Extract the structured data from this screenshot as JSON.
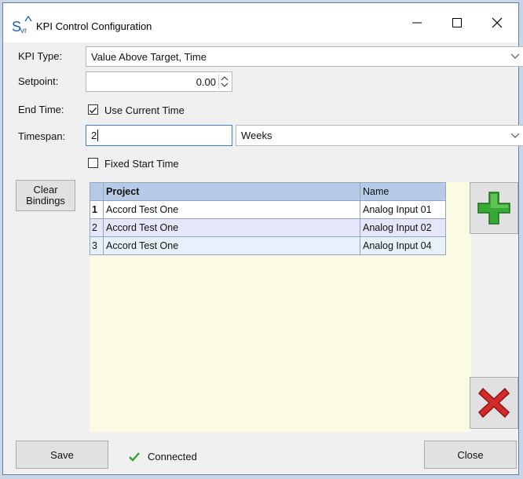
{
  "window": {
    "app_icon_text": "Svr",
    "title": "KPI Control Configuration",
    "buttons": [
      "minimize",
      "maximize",
      "close"
    ]
  },
  "form": {
    "kpi_type_label": "KPI Type:",
    "kpi_type_value": "Value Above Target, Time",
    "setpoint_label": "Setpoint:",
    "setpoint_value": "0.00",
    "end_time_label": "End Time:",
    "use_current_time_label": "Use Current Time",
    "use_current_time_checked": true,
    "timespan_label": "Timespan:",
    "timespan_value": "2",
    "timespan_unit": "Weeks",
    "fixed_start_time_label": "Fixed Start Time",
    "fixed_start_time_checked": false
  },
  "clear_bindings_label": "Clear Bindings",
  "grid": {
    "columns": [
      "Project",
      "Name"
    ],
    "rows": [
      {
        "index": "1",
        "project": "Accord Test One",
        "name": "Analog Input 01"
      },
      {
        "index": "2",
        "project": "Accord Test One",
        "name": "Analog Input 02"
      },
      {
        "index": "3",
        "project": "Accord Test One",
        "name": "Analog Input 04"
      }
    ]
  },
  "icons": {
    "add": "plus-icon",
    "delete": "x-icon",
    "status": "checkmark-icon",
    "add_color": "#39a935",
    "delete_color": "#d42a2a",
    "status_color": "#3a9b3a"
  },
  "footer": {
    "save_label": "Save",
    "status_text": "Connected",
    "close_label": "Close"
  }
}
